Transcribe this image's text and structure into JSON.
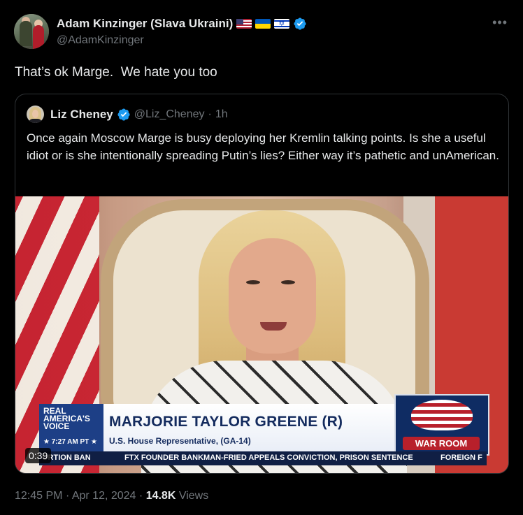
{
  "author": {
    "display_name": "Adam Kinzinger (Slava Ukraini)",
    "handle": "@AdamKinzinger",
    "flags": [
      "us-flag-icon",
      "ukraine-flag-icon",
      "israel-flag-icon"
    ],
    "verified": true
  },
  "tweet": {
    "text": "That’s ok Marge.  We hate you too",
    "time": "12:45 PM",
    "date": "Apr 12, 2024",
    "views_count": "14.8K",
    "views_label": "Views"
  },
  "quoted_tweet": {
    "display_name": "Liz Cheney",
    "handle": "@Liz_Cheney",
    "age": "1h",
    "verified": true,
    "text": "Once again Moscow Marge is busy deploying her Kremlin talking points. Is she a useful idiot or is she intentionally spreading Putin’s lies? Either way it’s pathetic and unAmerican.",
    "video": {
      "duration": "0:39",
      "chyron_brand": "REAL AMERICA'S VOICE",
      "chyron_time": "7:27 AM PT",
      "chyron_name": "MARJORIE TAYLOR GREENE (R)",
      "chyron_title": "U.S. House Representative, (GA-14)",
      "logo_text": "WAR ROOM",
      "ticker_items": [
        "ORTION BAN",
        "FTX FOUNDER BANKMAN-FRIED APPEALS CONVICTION, PRISON SENTENCE",
        "FOREIGN F"
      ]
    }
  },
  "colors": {
    "background": "#000000",
    "text_primary": "#e7e9ea",
    "text_secondary": "#71767b",
    "verified_blue": "#1d9bf0",
    "border": "#2f3336"
  }
}
